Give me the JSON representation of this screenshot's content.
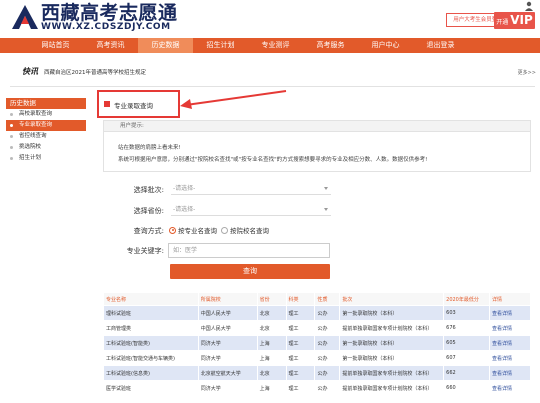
{
  "header": {
    "title": "西藏高考志愿通",
    "url": "WWW.XZ.CDSZDJY.COM",
    "login_label": "用户大考生会员登名",
    "vip_prefix": "开通",
    "vip_label": "VIP"
  },
  "nav": {
    "items": [
      "网站首页",
      "高考资讯",
      "历史数据",
      "招生计划",
      "专业测评",
      "高考服务",
      "用户中心",
      "退出登录"
    ],
    "active_index": 2
  },
  "breadcrumb": {
    "tag": "快讯",
    "text": "西藏自治区2021年普通高等学校招生规定",
    "more": "更多>>"
  },
  "sidebar": {
    "heading": "历史数据",
    "items": [
      "高校录取查询",
      "专业录取查询",
      "省控线查询",
      "挑选院校",
      "招生计划"
    ],
    "active_index": 1
  },
  "panel": {
    "title": "专业录取查询",
    "tip_heading": "用户提示:",
    "tip_line1": "站在数据的肩膀上看未来!",
    "tip_line2": "系统可根据用户意愿，分别通过\"按院校名查找\"或\"按专业名查找\"的方式搜索想要寻求的专业及相应分数、人数。数据仅供参考!"
  },
  "form": {
    "batch_label": "选择批次:",
    "batch_value": "-请选择-",
    "province_label": "选择省份:",
    "province_value": "-请选择-",
    "mode_label": "查询方式:",
    "mode_option1": "按专业名查询",
    "mode_option2": "按院校名查询",
    "keyword_label": "专业关键字:",
    "keyword_placeholder": "如：医学",
    "query_label": "查询"
  },
  "table": {
    "headers": [
      "专业名称",
      "所属院校",
      "省份",
      "科类",
      "性质",
      "批次",
      "2020年最低分",
      "详情"
    ],
    "rows": [
      [
        "理科试验班",
        "中国人民大学",
        "北京",
        "理工",
        "公办",
        "第一批录取院校（本科）",
        "603",
        "查看详情"
      ],
      [
        "工商管理类",
        "中国人民大学",
        "北京",
        "理工",
        "公办",
        "提前单独录取国家专项计划院校（本科）",
        "676",
        "查看详情"
      ],
      [
        "工科试验班(智能类)",
        "同济大学",
        "上海",
        "理工",
        "公办",
        "第一批录取院校（本科）",
        "605",
        "查看详情"
      ],
      [
        "工科试验班(智能交通与车辆类)",
        "同济大学",
        "上海",
        "理工",
        "公办",
        "第一批录取院校（本科）",
        "607",
        "查看详情"
      ],
      [
        "工科试验班(信息类)",
        "北京航空航天大学",
        "北京",
        "理工",
        "公办",
        "提前单独录取国家专项计划院校（本科）",
        "662",
        "查看详情"
      ],
      [
        "医学试验班",
        "同济大学",
        "上海",
        "理工",
        "公办",
        "提前单独录取国家专项计划院校（本科）",
        "660",
        "查看详情"
      ]
    ]
  },
  "colors": {
    "accent": "#e25a2a",
    "highlight_box": "#e53935",
    "logo_navy": "#1a2a5e",
    "row_stripe": "#dfe6f5"
  }
}
